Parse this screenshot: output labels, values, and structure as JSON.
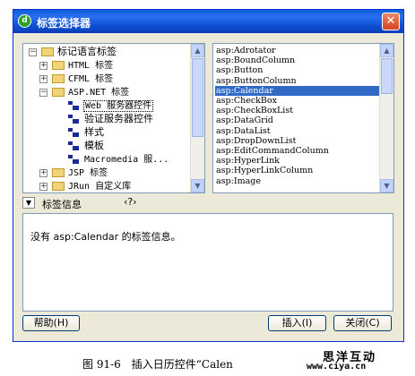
{
  "window": {
    "title": "标签选择器"
  },
  "tree": {
    "items": [
      {
        "label": "标记语言标签",
        "level": 0,
        "expander": "minus",
        "icon": "folder-icon"
      },
      {
        "label": "HTML 标签",
        "level": 1,
        "expander": "plus",
        "icon": "folder-icon"
      },
      {
        "label": "CFML 标签",
        "level": 1,
        "expander": "plus",
        "icon": "folder-icon"
      },
      {
        "label": "ASP.NET 标签",
        "level": 1,
        "expander": "minus",
        "icon": "folder-icon"
      },
      {
        "label": "Web 服务器控件",
        "level": 2,
        "icon": "tag-icon",
        "selected": true
      },
      {
        "label": "验证服务器控件",
        "level": 2,
        "icon": "tag-icon"
      },
      {
        "label": "样式",
        "level": 2,
        "icon": "tag-icon"
      },
      {
        "label": "模板",
        "level": 2,
        "icon": "tag-icon"
      },
      {
        "label": "Macromedia 服...",
        "level": 2,
        "icon": "tag-icon"
      },
      {
        "label": "JSP 标签",
        "level": 1,
        "expander": "plus",
        "icon": "folder-icon"
      },
      {
        "label": "JRun 自定义库",
        "level": 1,
        "expander": "plus",
        "icon": "folder-icon"
      }
    ]
  },
  "taglist": {
    "items": [
      "asp:Adrotator",
      "asp:BoundColumn",
      "asp:Button",
      "asp:ButtonColumn",
      "asp:Calendar",
      "asp:CheckBox",
      "asp:CheckBoxList",
      "asp:DataGrid",
      "asp:DataList",
      "asp:DropDownList",
      "asp:EditCommandColumn",
      "asp:HyperLink",
      "asp:HyperLinkColumn",
      "asp:Image"
    ],
    "selected": "asp:Calendar"
  },
  "info": {
    "title": "标签信息",
    "text": "没有 asp:Calendar 的标签信息。"
  },
  "buttons": {
    "help": "帮助(H)",
    "insert": "插入(I)",
    "close": "关闭(C)"
  },
  "caption": "图 91-6　插入日历控件“Calen",
  "watermark": {
    "line1": "思洋互动",
    "line2": "www.ciya.cn"
  }
}
